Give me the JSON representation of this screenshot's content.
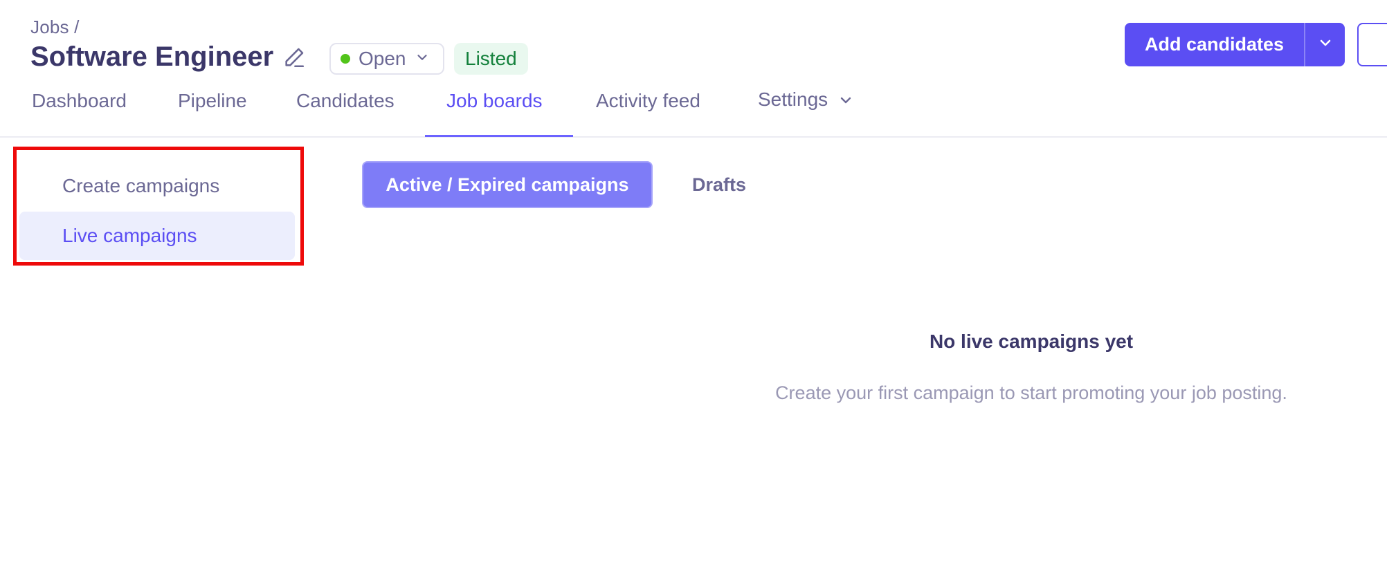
{
  "header": {
    "breadcrumb": "Jobs /",
    "title": "Software Engineer",
    "status": {
      "label": "Open",
      "dot_color": "#52c41a"
    },
    "badge": "Listed",
    "add_candidates_label": "Add candidates"
  },
  "tabs": [
    {
      "label": "Dashboard"
    },
    {
      "label": "Pipeline"
    },
    {
      "label": "Candidates"
    },
    {
      "label": "Job boards",
      "active": true
    },
    {
      "label": "Activity feed"
    },
    {
      "label": "Settings"
    }
  ],
  "side_menu": {
    "items": [
      {
        "label": "Create campaigns"
      },
      {
        "label": "Live campaigns",
        "active": true
      }
    ]
  },
  "sub_tabs": [
    {
      "label": "Active / Expired campaigns",
      "active": true
    },
    {
      "label": "Drafts"
    }
  ],
  "empty_state": {
    "title": "No live campaigns yet",
    "description": "Create your first campaign to start promoting your job posting."
  },
  "colors": {
    "accent": "#5b4ef3",
    "highlight_box": "#ee0a0a",
    "badge_bg": "#e9f8ef",
    "badge_text": "#13803b"
  }
}
